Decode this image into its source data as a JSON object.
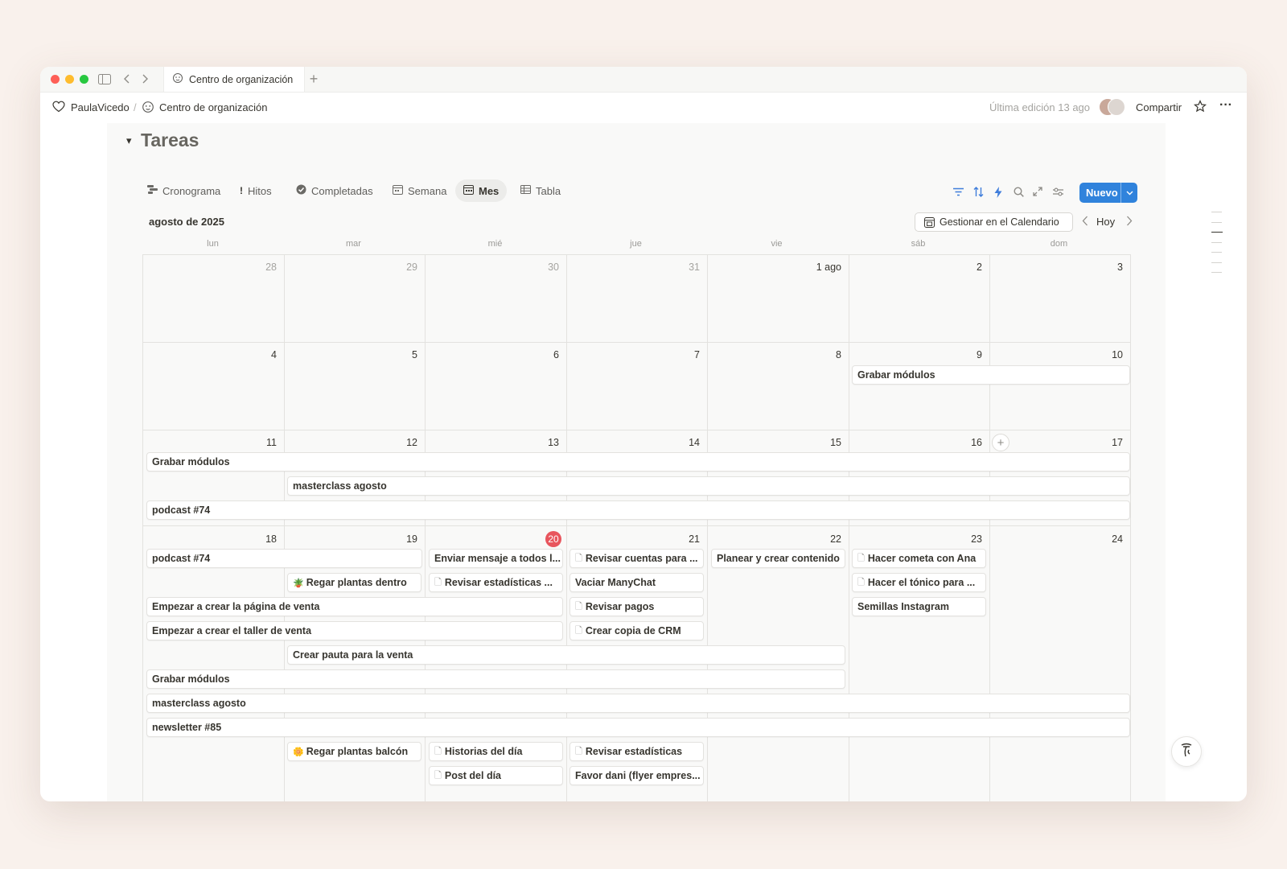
{
  "window": {
    "tab_title": "Centro de organización",
    "new_tab": "+"
  },
  "breadcrumb": {
    "workspace": "PaulaVicedo",
    "separator": "/",
    "page": "Centro de organización",
    "last_edit": "Última edición 13 ago",
    "share": "Compartir",
    "more": "···"
  },
  "section": {
    "title": "Tareas",
    "toggle": "▾"
  },
  "views": [
    {
      "label": "Cronograma",
      "icon": "timeline-icon"
    },
    {
      "label": "Hitos",
      "icon": "exclamation-icon"
    },
    {
      "label": "Completadas",
      "icon": "check-circle-icon"
    },
    {
      "label": "Semana",
      "icon": "calendar-icon"
    },
    {
      "label": "Mes",
      "icon": "calendar-icon",
      "active": true
    },
    {
      "label": "Tabla",
      "icon": "table-icon"
    }
  ],
  "toolbar": {
    "new_label": "Nuevo",
    "accent": "#3083dc"
  },
  "calendar": {
    "month_label": "agosto de 2025",
    "manage_label": "Gestionar en el Calendario",
    "today_label": "Hoy",
    "weekdays": [
      "lun",
      "mar",
      "mié",
      "jue",
      "vie",
      "sáb",
      "dom"
    ],
    "weeks": [
      [
        "28",
        "29",
        "30",
        "31",
        "1 ago",
        "2",
        "3"
      ],
      [
        "4",
        "5",
        "6",
        "7",
        "8",
        "9",
        "10"
      ],
      [
        "11",
        "12",
        "13",
        "14",
        "15",
        "16",
        "17"
      ],
      [
        "18",
        "19",
        "20",
        "21",
        "22",
        "23",
        "24"
      ]
    ],
    "today": "20",
    "today_color": "#e8555d",
    "events": {
      "w2_grabar": "Grabar módulos",
      "w3_grabar": "Grabar módulos",
      "w3_masterclass": "masterclass agosto",
      "w3_podcast": "podcast #74",
      "w4_podcast": "podcast #74",
      "w4_enviar": "Enviar mensaje a todos l...",
      "w4_revisar_cuentas": "Revisar cuentas para ...",
      "w4_planear": "Planear y crear contenido",
      "w4_cometa": "Hacer cometa con Ana",
      "w4_regar_dentro": "Regar plantas dentro",
      "w4_revisar_estad": "Revisar estadísticas ...",
      "w4_vaciar": "Vaciar ManyChat",
      "w4_tonico": "Hacer el tónico para ...",
      "w4_pagina": "Empezar a crear la página de venta",
      "w4_pagos": "Revisar pagos",
      "w4_semillas": "Semillas Instagram",
      "w4_taller": "Empezar a crear el taller de venta",
      "w4_crm": "Crear copia de CRM",
      "w4_pauta": "Crear pauta para la venta",
      "w4_grabar": "Grabar módulos",
      "w4_masterclass": "masterclass agosto",
      "w4_newsletter": "newsletter #85",
      "w4_regar_balcon": "Regar plantas balcón",
      "w4_historias": "Historias del día",
      "w4_revisar_estadisticas": "Revisar estadísticas",
      "w4_post": "Post del día",
      "w4_favor": "Favor dani (flyer empres..."
    }
  }
}
